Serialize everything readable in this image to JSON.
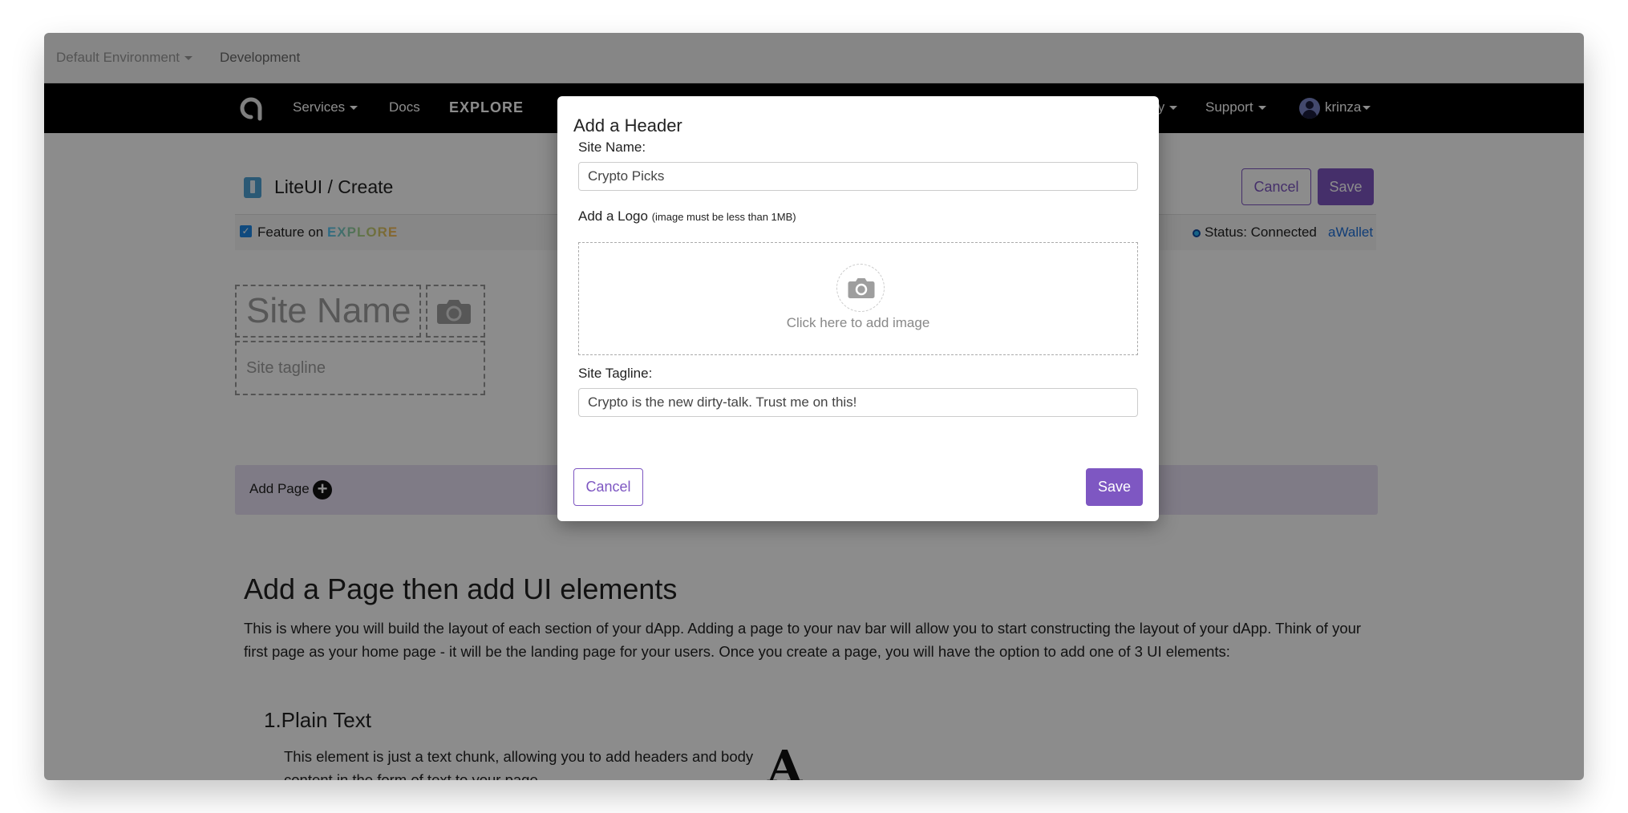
{
  "env": {
    "environment_label": "Default Environment",
    "branch_label": "Development"
  },
  "nav": {
    "logo_icon": "a-logo-icon",
    "items": [
      {
        "label": "Services",
        "dropdown": true
      },
      {
        "label": "Docs",
        "dropdown": false
      },
      {
        "label": "EXPLORE",
        "dropdown": false
      },
      {
        "label": "mmunity",
        "dropdown": true
      },
      {
        "label": "Support",
        "dropdown": true
      }
    ],
    "user": "krinza"
  },
  "page": {
    "breadcrumb": "LiteUI / Create",
    "cancel_label": "Cancel",
    "save_label": "Save",
    "feature_prefix": "Feature on",
    "feature_brand": "EXPLORE",
    "feature_checked": true,
    "status_text": "Status: Connected",
    "wallet_link": "aWallet",
    "site_name_placeholder": "Site Name",
    "site_tagline_placeholder": "Site tagline",
    "add_page_label": "Add Page",
    "heading": "Add a Page then add UI elements",
    "intro": "This is where you will build the layout of each section of your dApp. Adding a page to your nav bar will allow you to start constructing the layout of your dApp. Think of your first page as your home page - it will be the landing page for your users. Once you create a page, you will have the option to add one of 3 UI elements:",
    "sub_heading": "1.Plain Text",
    "sub_text": "This element is just a text chunk, allowing you to add headers and body content in the form of text to your page.",
    "sub_icon_glyph": "A"
  },
  "modal": {
    "title": "Add a Header",
    "site_name_label": "Site Name:",
    "site_name_value": "Crypto Picks",
    "logo_label": "Add a Logo",
    "logo_hint": "(image must be less than 1MB)",
    "dropzone_text": "Click here to add image",
    "tagline_label": "Site Tagline:",
    "tagline_value": "Crypto is the new dirty-talk. Trust me on this!",
    "cancel_label": "Cancel",
    "save_label": "Save"
  },
  "colors": {
    "accent": "#7e57c2",
    "link": "#1e6fd9",
    "overlay": "rgba(0,0,0,0.45)"
  }
}
